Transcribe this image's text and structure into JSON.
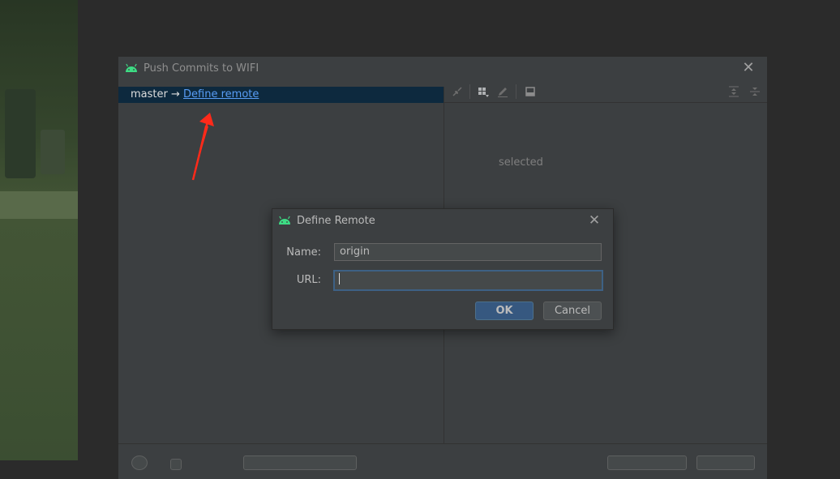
{
  "main_dialog": {
    "title": "Push Commits to WIFI",
    "close_glyph": "✕",
    "branch": {
      "local": "master",
      "arrow": "→",
      "remote_link": "Define remote"
    },
    "empty_state": "selected"
  },
  "define_remote": {
    "title": "Define Remote",
    "close_glyph": "✕",
    "name_label": "Name:",
    "name_value": "origin",
    "url_label": "URL:",
    "url_value": "",
    "ok_label": "OK",
    "cancel_label": "Cancel"
  },
  "icons": {
    "app": "android-icon",
    "toolbar": [
      "expand-arrows-icon",
      "group-by-icon",
      "edit-icon",
      "preview-icon",
      "expand-all-icon",
      "collapse-all-icon"
    ]
  },
  "colors": {
    "android_green": "#3ddc84",
    "link": "#589df6",
    "selection": "#0d293e",
    "ok_button": "#365880",
    "annotation_arrow": "#ff2a1a"
  }
}
